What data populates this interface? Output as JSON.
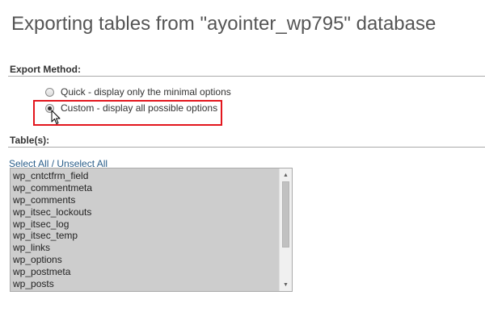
{
  "page": {
    "title": "Exporting tables from \"ayointer_wp795\" database"
  },
  "export_method": {
    "heading": "Export Method:",
    "options": [
      {
        "label": "Quick - display only the minimal options",
        "checked": false
      },
      {
        "label": "Custom - display all possible options",
        "checked": true
      }
    ],
    "highlight_color": "#e3161d"
  },
  "tables": {
    "heading": "Table(s):",
    "select_link": "Select All / Unselect All",
    "items": [
      "wp_cntctfrm_field",
      "wp_commentmeta",
      "wp_comments",
      "wp_itsec_lockouts",
      "wp_itsec_log",
      "wp_itsec_temp",
      "wp_links",
      "wp_options",
      "wp_postmeta",
      "wp_posts"
    ]
  },
  "icons": {
    "cursor": "mouse-pointer-icon",
    "scroll_up": "chevron-up-icon",
    "scroll_down": "chevron-down-icon"
  }
}
